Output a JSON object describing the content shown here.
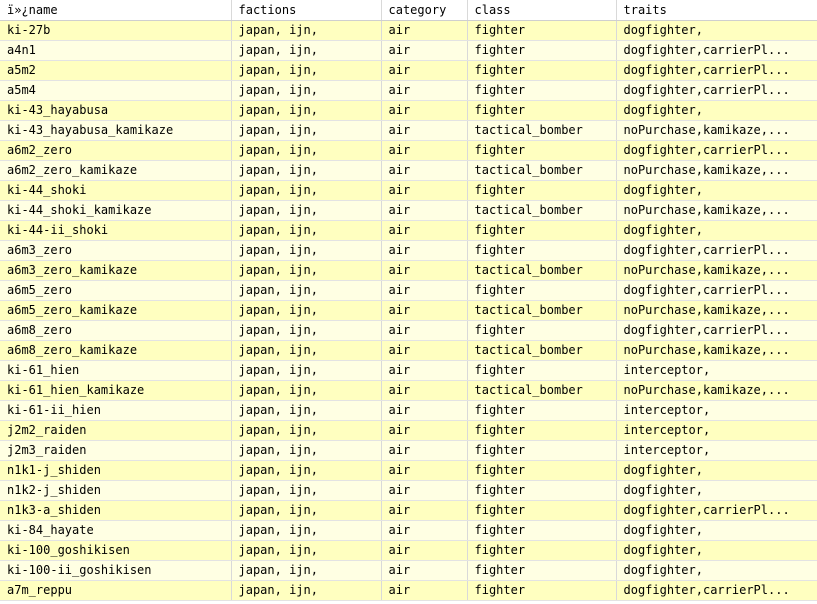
{
  "columns": [
    "ï»¿name",
    "factions",
    "category",
    "class",
    "traits"
  ],
  "rows": [
    [
      "ki-27b",
      "japan, ijn,",
      "air",
      "fighter",
      "dogfighter,"
    ],
    [
      "a4n1",
      "japan, ijn,",
      "air",
      "fighter",
      "dogfighter,carrierPl..."
    ],
    [
      "a5m2",
      "japan, ijn,",
      "air",
      "fighter",
      "dogfighter,carrierPl..."
    ],
    [
      "a5m4",
      "japan, ijn,",
      "air",
      "fighter",
      "dogfighter,carrierPl..."
    ],
    [
      "ki-43_hayabusa",
      "japan, ijn,",
      "air",
      "fighter",
      "dogfighter,"
    ],
    [
      "ki-43_hayabusa_kamikaze",
      "japan, ijn,",
      "air",
      "tactical_bomber",
      "noPurchase,kamikaze,..."
    ],
    [
      "a6m2_zero",
      "japan, ijn,",
      "air",
      "fighter",
      "dogfighter,carrierPl..."
    ],
    [
      "a6m2_zero_kamikaze",
      "japan, ijn,",
      "air",
      "tactical_bomber",
      "noPurchase,kamikaze,..."
    ],
    [
      "ki-44_shoki",
      "japan, ijn,",
      "air",
      "fighter",
      "dogfighter,"
    ],
    [
      "ki-44_shoki_kamikaze",
      "japan, ijn,",
      "air",
      "tactical_bomber",
      "noPurchase,kamikaze,..."
    ],
    [
      "ki-44-ii_shoki",
      "japan, ijn,",
      "air",
      "fighter",
      "dogfighter,"
    ],
    [
      "a6m3_zero",
      "japan, ijn,",
      "air",
      "fighter",
      "dogfighter,carrierPl..."
    ],
    [
      "a6m3_zero_kamikaze",
      "japan, ijn,",
      "air",
      "tactical_bomber",
      "noPurchase,kamikaze,..."
    ],
    [
      "a6m5_zero",
      "japan, ijn,",
      "air",
      "fighter",
      "dogfighter,carrierPl..."
    ],
    [
      "a6m5_zero_kamikaze",
      "japan, ijn,",
      "air",
      "tactical_bomber",
      "noPurchase,kamikaze,..."
    ],
    [
      "a6m8_zero",
      "japan, ijn,",
      "air",
      "fighter",
      "dogfighter,carrierPl..."
    ],
    [
      "a6m8_zero_kamikaze",
      "japan, ijn,",
      "air",
      "tactical_bomber",
      "noPurchase,kamikaze,..."
    ],
    [
      "ki-61_hien",
      "japan, ijn,",
      "air",
      "fighter",
      "interceptor,"
    ],
    [
      "ki-61_hien_kamikaze",
      "japan, ijn,",
      "air",
      "tactical_bomber",
      "noPurchase,kamikaze,..."
    ],
    [
      "ki-61-ii_hien",
      "japan, ijn,",
      "air",
      "fighter",
      "interceptor,"
    ],
    [
      "j2m2_raiden",
      "japan, ijn,",
      "air",
      "fighter",
      "interceptor,"
    ],
    [
      "j2m3_raiden",
      "japan, ijn,",
      "air",
      "fighter",
      "interceptor,"
    ],
    [
      "n1k1-j_shiden",
      "japan, ijn,",
      "air",
      "fighter",
      "dogfighter,"
    ],
    [
      "n1k2-j_shiden",
      "japan, ijn,",
      "air",
      "fighter",
      "dogfighter,"
    ],
    [
      "n1k3-a_shiden",
      "japan, ijn,",
      "air",
      "fighter",
      "dogfighter,carrierPl..."
    ],
    [
      "ki-84_hayate",
      "japan, ijn,",
      "air",
      "fighter",
      "dogfighter,"
    ],
    [
      "ki-100_goshikisen",
      "japan, ijn,",
      "air",
      "fighter",
      "dogfighter,"
    ],
    [
      "ki-100-ii_goshikisen",
      "japan, ijn,",
      "air",
      "fighter",
      "dogfighter,"
    ],
    [
      "a7m_reppu",
      "japan, ijn,",
      "air",
      "fighter",
      "dogfighter,carrierPl..."
    ]
  ]
}
